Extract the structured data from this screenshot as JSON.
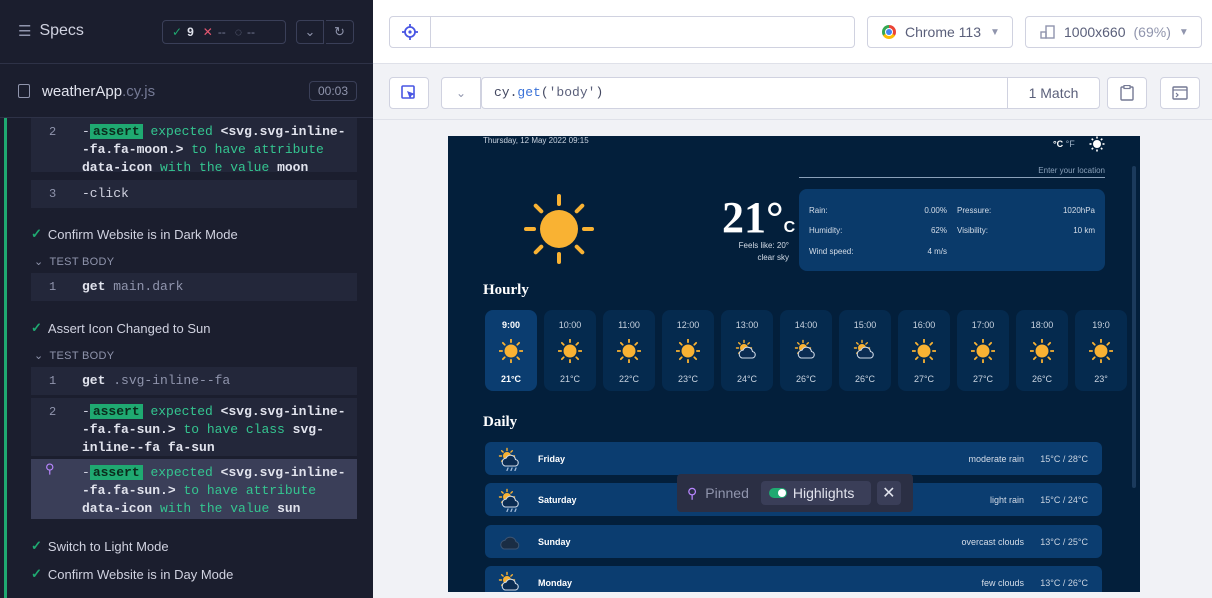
{
  "reporter": {
    "header": {
      "title": "Specs",
      "passed": "9",
      "failed": "--",
      "pending": "--"
    },
    "file": {
      "name": "weatherApp",
      "ext": ".cy.js",
      "duration": "00:03"
    },
    "commands": [
      {
        "num": "2",
        "badge": "assert",
        "pre": "-",
        "t1": "expected",
        "v1": "<svg.svg-inline--fa.fa-moon.>",
        "t2": "to have attribute",
        "v2": "data-icon",
        "t3": "with the value",
        "v3": "moon"
      },
      {
        "num": "3",
        "text": "-click"
      }
    ],
    "tests": [
      {
        "title": "Confirm Website is in Dark Mode"
      },
      {
        "title": "Assert Icon Changed to Sun"
      },
      {
        "title": "Switch to Light Mode"
      },
      {
        "title": "Confirm Website is in Day Mode"
      }
    ],
    "test_body_label": "TEST BODY",
    "dark_cmd": {
      "num": "1",
      "kw": "get",
      "arg": "main.dark"
    },
    "sun_cmds": [
      {
        "num": "1",
        "kw": "get",
        "arg": ".svg-inline--fa"
      },
      {
        "num": "2",
        "pre": "-",
        "badge": "assert",
        "t1": "expected",
        "v1": "<svg.svg-inline--fa.fa-sun.>",
        "t2": "to have class",
        "v2": "svg-inline--fa fa-sun"
      },
      {
        "pre": "-",
        "badge": "assert",
        "t1": "expected",
        "v1": "<svg.svg-inline--fa.fa-sun.>",
        "t2": "to have attribute",
        "v2": "data-icon",
        "t3": "with the value",
        "v3": "sun"
      }
    ]
  },
  "runner": {
    "url": "",
    "browser": "Chrome 113",
    "viewport": "1000x660",
    "zoom": "(69%)",
    "selector": {
      "method": "get",
      "arg": "'body'",
      "matches": "1 Match"
    }
  },
  "pinned": {
    "label": "Pinned",
    "highlights": "Highlights"
  },
  "weather": {
    "date": "Thursday, 12 May 2022 09:15",
    "unit_c": "°C",
    "unit_f": "°F",
    "location_placeholder": "Enter your location",
    "temp": "21°",
    "temp_unit": "C",
    "feels": "Feels like: 20°",
    "condition": "clear sky",
    "details": [
      {
        "k": "Rain:",
        "v": "0.00%"
      },
      {
        "k": "Humidity:",
        "v": "62%"
      },
      {
        "k": "Wind speed:",
        "v": "4 m/s"
      },
      {
        "k": "Pressure:",
        "v": "1020hPa"
      },
      {
        "k": "Visibility:",
        "v": "10 km"
      }
    ],
    "hourly_title": "Hourly",
    "hourly": [
      {
        "t": "9:00",
        "tp": "21°C",
        "icon": "sun-icon"
      },
      {
        "t": "10:00",
        "tp": "21°C",
        "icon": "sun-icon"
      },
      {
        "t": "11:00",
        "tp": "22°C",
        "icon": "sun-icon"
      },
      {
        "t": "12:00",
        "tp": "23°C",
        "icon": "sun-icon"
      },
      {
        "t": "13:00",
        "tp": "24°C",
        "icon": "cloud-sun-icon"
      },
      {
        "t": "14:00",
        "tp": "26°C",
        "icon": "cloud-sun-icon"
      },
      {
        "t": "15:00",
        "tp": "26°C",
        "icon": "cloud-sun-icon"
      },
      {
        "t": "16:00",
        "tp": "27°C",
        "icon": "sun-icon"
      },
      {
        "t": "17:00",
        "tp": "27°C",
        "icon": "sun-icon"
      },
      {
        "t": "18:00",
        "tp": "26°C",
        "icon": "sun-icon"
      },
      {
        "t": "19:0",
        "tp": "23°",
        "icon": "sun-icon"
      }
    ],
    "daily_title": "Daily",
    "daily": [
      {
        "name": "Friday",
        "desc": "moderate rain",
        "range": "15°C / 28°C",
        "icon": "cloud-sun-rain-icon"
      },
      {
        "name": "Saturday",
        "desc": "light rain",
        "range": "15°C / 24°C",
        "icon": "cloud-sun-rain-icon"
      },
      {
        "name": "Sunday",
        "desc": "overcast clouds",
        "range": "13°C / 25°C",
        "icon": "cloud-icon"
      },
      {
        "name": "Monday",
        "desc": "few clouds",
        "range": "13°C / 26°C",
        "icon": "cloud-sun-icon"
      }
    ]
  }
}
